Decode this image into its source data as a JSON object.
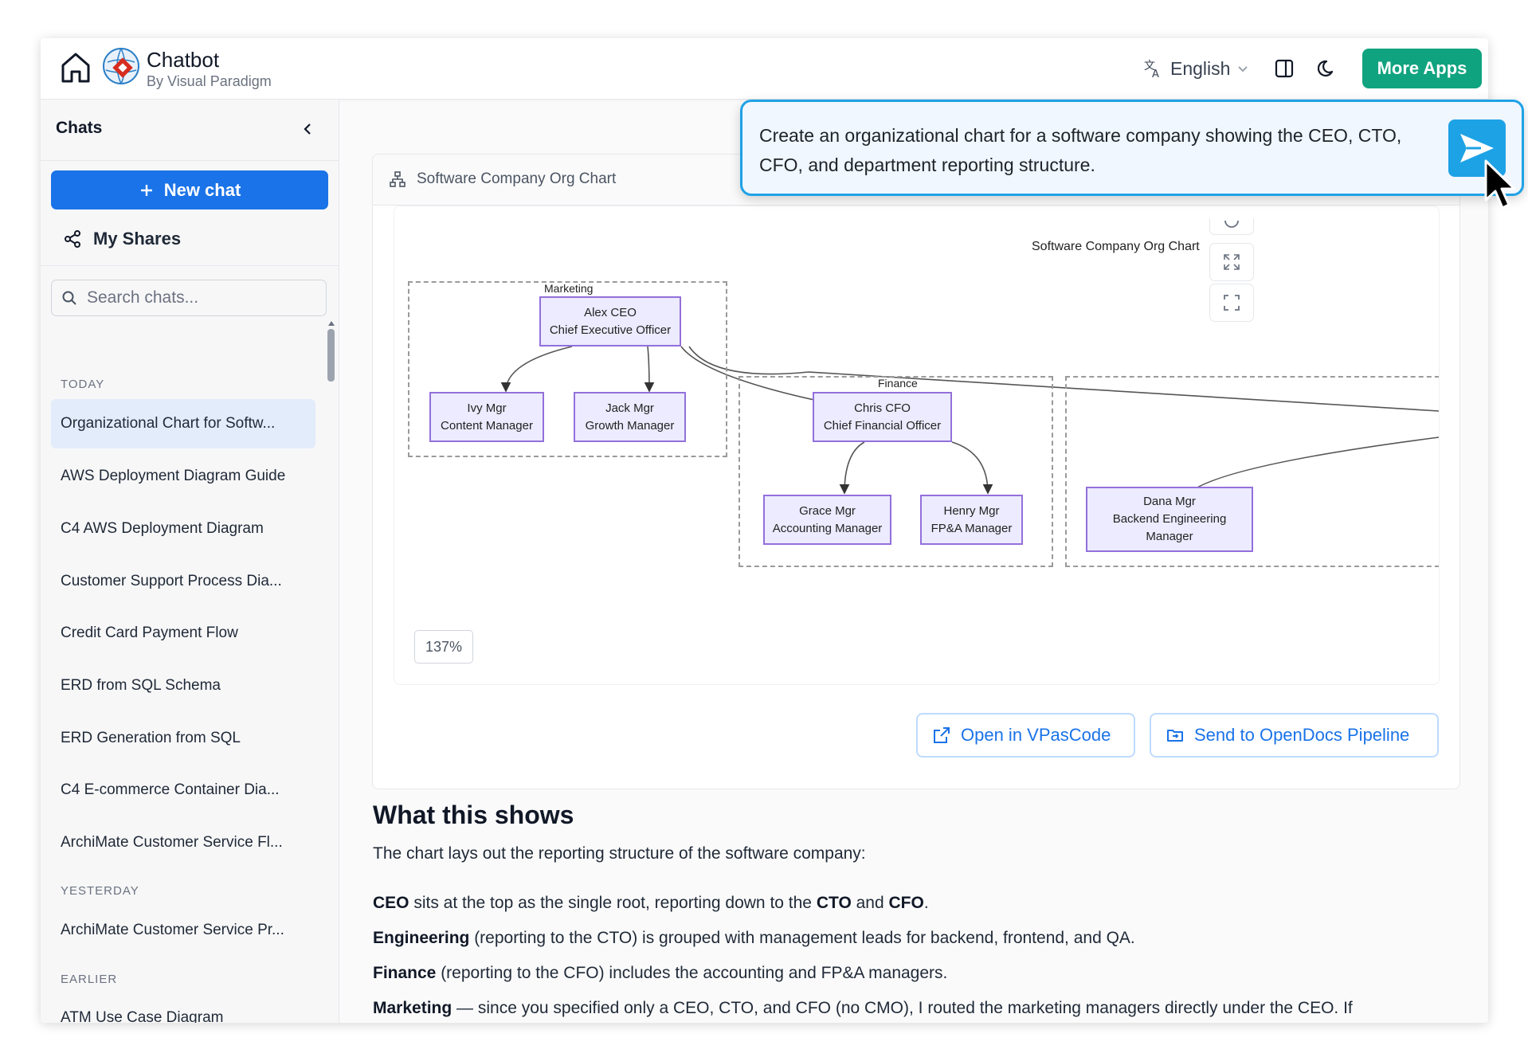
{
  "header": {
    "app_title": "Chatbot",
    "app_subtitle": "By Visual Paradigm",
    "language": "English",
    "more_apps": "More Apps"
  },
  "sidebar": {
    "title": "Chats",
    "new_chat": "New chat",
    "my_shares": "My Shares",
    "search_placeholder": "Search chats...",
    "sections": [
      {
        "label": "TODAY",
        "items": [
          "Organizational Chart for Softw...",
          "AWS Deployment Diagram Guide",
          "C4 AWS Deployment Diagram",
          "Customer Support Process Dia...",
          "Credit Card Payment Flow",
          "ERD from SQL Schema",
          "ERD Generation from SQL",
          "C4 E-commerce Container Dia...",
          "ArchiMate Customer Service Fl..."
        ]
      },
      {
        "label": "YESTERDAY",
        "items": [
          "ArchiMate Customer Service Pr..."
        ]
      },
      {
        "label": "EARLIER",
        "items": [
          "ATM Use Case Diagram"
        ]
      }
    ]
  },
  "card": {
    "title": "Software Company Org Chart",
    "zoom": "137%",
    "open_vpascode": "Open in VPasCode",
    "send_opendocs": "Send to OpenDocs Pipeline"
  },
  "diagram": {
    "title": "Software Company Org Chart",
    "clusters": {
      "marketing": "Marketing",
      "finance": "Finance"
    },
    "nodes": {
      "ceo": {
        "name": "Alex CEO",
        "role": "Chief Executive Officer"
      },
      "ivy": {
        "name": "Ivy Mgr",
        "role": "Content Manager"
      },
      "jack": {
        "name": "Jack Mgr",
        "role": "Growth Manager"
      },
      "cfo": {
        "name": "Chris CFO",
        "role": "Chief Financial Officer"
      },
      "grace": {
        "name": "Grace Mgr",
        "role": "Accounting Manager"
      },
      "henry": {
        "name": "Henry Mgr",
        "role": "FP&A Manager"
      },
      "dana": {
        "name": "Dana Mgr",
        "role": "Backend Engineering",
        "role2": "Manager"
      }
    }
  },
  "content": {
    "heading": "What this shows",
    "intro": "The chart lays out the reporting structure of the software company:",
    "p1": {
      "b1": "CEO",
      "t1": " sits at the top as the single root, reporting down to the ",
      "b2": "CTO",
      "t2": " and ",
      "b3": "CFO",
      "t3": "."
    },
    "p2": {
      "b": "Engineering",
      "t": " (reporting to the CTO) is grouped with management leads for backend, frontend, and QA."
    },
    "p3": {
      "b": "Finance",
      "t": " (reporting to the CFO) includes the accounting and FP&A managers."
    },
    "p4": {
      "b": "Marketing",
      "t": " — since you specified only a CEO, CTO, and CFO (no CMO), I routed the marketing managers directly under the CEO. If"
    }
  },
  "prompt": {
    "text": "Create an organizational chart for a software company showing the CEO, CTO, CFO, and department reporting structure."
  },
  "colors": {
    "brand_blue": "#1a73e8",
    "more_apps_green": "#10a37f",
    "node_fill": "#ecebff",
    "node_border": "#9370db",
    "prompt_border": "#1ea2e6"
  }
}
